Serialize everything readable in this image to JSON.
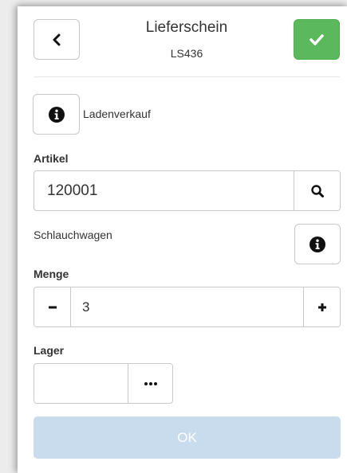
{
  "header": {
    "title": "Lieferschein",
    "subtitle": "LS436",
    "back_icon": "chevron-left-icon",
    "confirm_icon": "check-icon",
    "confirm_color": "#5cb85c"
  },
  "customer": {
    "label": "Ladenverkauf",
    "icon": "info-circle-icon"
  },
  "artikel": {
    "label": "Artikel",
    "value": "120001",
    "search_icon": "search-icon",
    "name": "Schlauchwagen",
    "info_icon": "info-circle-icon"
  },
  "menge": {
    "label": "Menge",
    "value": "3",
    "decrement_icon": "minus-icon",
    "increment_icon": "plus-icon"
  },
  "lager": {
    "label": "Lager",
    "value": "",
    "more_icon": "ellipsis-icon"
  },
  "ok_button": {
    "label": "OK",
    "color": "#c8dcee",
    "disabled": true
  }
}
